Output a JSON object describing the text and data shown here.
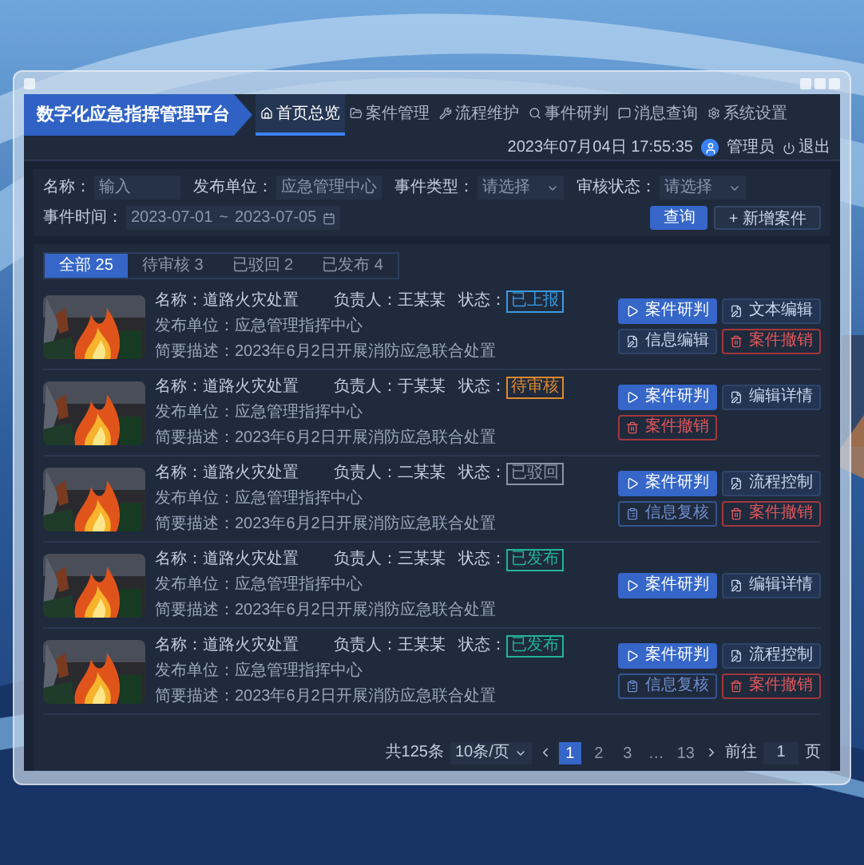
{
  "app": {
    "title": "数字化应急指挥管理平台"
  },
  "nav": [
    {
      "label": "首页总览",
      "selected": true
    },
    {
      "label": "案件管理",
      "selected": false
    },
    {
      "label": "流程维护",
      "selected": false
    },
    {
      "label": "事件研判",
      "selected": false
    },
    {
      "label": "消息查询",
      "selected": false
    },
    {
      "label": "系统设置",
      "selected": false
    }
  ],
  "header": {
    "datetime": "2023年07月04日 17:55:35",
    "user": "管理员",
    "logout": "退出"
  },
  "filters": [
    {
      "kind": "input",
      "label": "名称：",
      "value": "输入"
    },
    {
      "kind": "input",
      "label": "发布单位：",
      "value": "应急管理中心"
    },
    {
      "kind": "select",
      "label": "事件类型：",
      "value": "请选择"
    },
    {
      "kind": "select",
      "label": "审核状态：",
      "value": "请选择"
    },
    {
      "kind": "date",
      "label": "事件时间：",
      "start": "2023-07-01",
      "separator": "~",
      "end": "2023-07-05"
    }
  ],
  "actions": [
    {
      "kind": "primary",
      "label": "查询"
    },
    {
      "kind": "add",
      "label": "+ 新增案件"
    }
  ],
  "tabs": [
    {
      "label": "全部",
      "count": "25",
      "selected": true
    },
    {
      "label": "待审核",
      "count": "3",
      "selected": false
    },
    {
      "label": "已驳回",
      "count": "2",
      "selected": false
    },
    {
      "label": "已发布",
      "count": "4",
      "selected": false
    }
  ],
  "rows": [
    {
      "name": "名称：道路火灾处置",
      "unit": "发布单位：应急管理指挥中心",
      "description": "简要描述：2023年6月2日开展消防应急联合处置",
      "person_label": "负责人：",
      "person": "王某某",
      "status_label": "状态：",
      "status": "已上报",
      "color": "#3b9ae1",
      "buttons": [
        {
          "kind": "primary",
          "label": "案件研判"
        },
        {
          "kind": "default",
          "label": "文本编辑"
        },
        {
          "kind": "default",
          "label": "信息编辑"
        },
        {
          "kind": "danger",
          "label": "案件撤销"
        }
      ]
    },
    {
      "name": "名称：道路火灾处置",
      "unit": "发布单位：应急管理指挥中心",
      "description": "简要描述：2023年6月2日开展消防应急联合处置",
      "person_label": "负责人：",
      "person": "于某某",
      "status_label": "状态：",
      "status": "待审核",
      "color": "#e08a2c",
      "buttons": [
        {
          "kind": "primary",
          "label": "案件研判"
        },
        {
          "kind": "default",
          "label": "编辑详情"
        },
        {
          "kind": "danger",
          "label": "案件撤销"
        }
      ]
    },
    {
      "name": "名称：道路火灾处置",
      "unit": "发布单位：应急管理指挥中心",
      "description": "简要描述：2023年6月2日开展消防应急联合处置",
      "person_label": "负责人：",
      "person": "二某某",
      "status_label": "状态：",
      "status": "已驳回",
      "color": "#8a94a6",
      "buttons": [
        {
          "kind": "primary",
          "label": "案件研判"
        },
        {
          "kind": "default",
          "label": "流程控制"
        },
        {
          "kind": "outline",
          "label": "信息复核"
        },
        {
          "kind": "danger",
          "label": "案件撤销"
        }
      ]
    },
    {
      "name": "名称：道路火灾处置",
      "unit": "发布单位：应急管理指挥中心",
      "description": "简要描述：2023年6月2日开展消防应急联合处置",
      "person_label": "负责人：",
      "person": "三某某",
      "status_label": "状态：",
      "status": "已发布",
      "color": "#22b59a",
      "buttons": [
        {
          "kind": "primary",
          "label": "案件研判"
        },
        {
          "kind": "default",
          "label": "编辑详情"
        }
      ]
    },
    {
      "name": "名称：道路火灾处置",
      "unit": "发布单位：应急管理指挥中心",
      "description": "简要描述：2023年6月2日开展消防应急联合处置",
      "person_label": "负责人：",
      "person": "王某某",
      "status_label": "状态：",
      "status": "已发布",
      "color": "#22b59a",
      "buttons": [
        {
          "kind": "primary",
          "label": "案件研判"
        },
        {
          "kind": "default",
          "label": "流程控制"
        },
        {
          "kind": "outline",
          "label": "信息复核"
        },
        {
          "kind": "danger",
          "label": "案件撤销"
        }
      ]
    }
  ],
  "pagination": {
    "total": "共125条",
    "page_size": "10条/页",
    "pages": [
      {
        "label": "1",
        "selected": true
      },
      {
        "label": "2",
        "selected": false
      },
      {
        "label": "3",
        "selected": false
      },
      {
        "label": "…",
        "selected": false
      },
      {
        "label": "13",
        "selected": false
      }
    ],
    "goto": "前往",
    "goto_value": "1",
    "page_unit": "页"
  }
}
